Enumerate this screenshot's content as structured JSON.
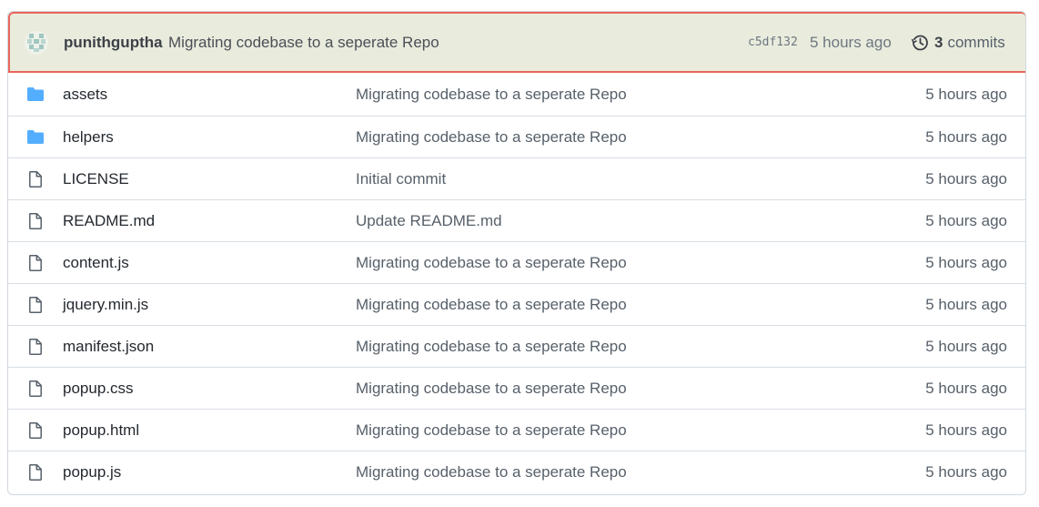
{
  "latest_commit": {
    "author": "punithguptha",
    "message": "Migrating codebase to a seperate Repo",
    "sha": "c5df132",
    "time": "5 hours ago",
    "commits_count": "3",
    "commits_label": "commits"
  },
  "files": [
    {
      "type": "folder",
      "name": "assets",
      "message": "Migrating codebase to a seperate Repo",
      "age": "5 hours ago"
    },
    {
      "type": "folder",
      "name": "helpers",
      "message": "Migrating codebase to a seperate Repo",
      "age": "5 hours ago"
    },
    {
      "type": "file",
      "name": "LICENSE",
      "message": "Initial commit",
      "age": "5 hours ago"
    },
    {
      "type": "file",
      "name": "README.md",
      "message": "Update README.md",
      "age": "5 hours ago"
    },
    {
      "type": "file",
      "name": "content.js",
      "message": "Migrating codebase to a seperate Repo",
      "age": "5 hours ago"
    },
    {
      "type": "file",
      "name": "jquery.min.js",
      "message": "Migrating codebase to a seperate Repo",
      "age": "5 hours ago"
    },
    {
      "type": "file",
      "name": "manifest.json",
      "message": "Migrating codebase to a seperate Repo",
      "age": "5 hours ago"
    },
    {
      "type": "file",
      "name": "popup.css",
      "message": "Migrating codebase to a seperate Repo",
      "age": "5 hours ago"
    },
    {
      "type": "file",
      "name": "popup.html",
      "message": "Migrating codebase to a seperate Repo",
      "age": "5 hours ago"
    },
    {
      "type": "file",
      "name": "popup.js",
      "message": "Migrating codebase to a seperate Repo",
      "age": "5 hours ago"
    }
  ],
  "colors": {
    "folder": "#54aeff",
    "file_icon": "#57606a",
    "header_bg": "#e9ecdd",
    "highlight_border": "#e9665b"
  }
}
